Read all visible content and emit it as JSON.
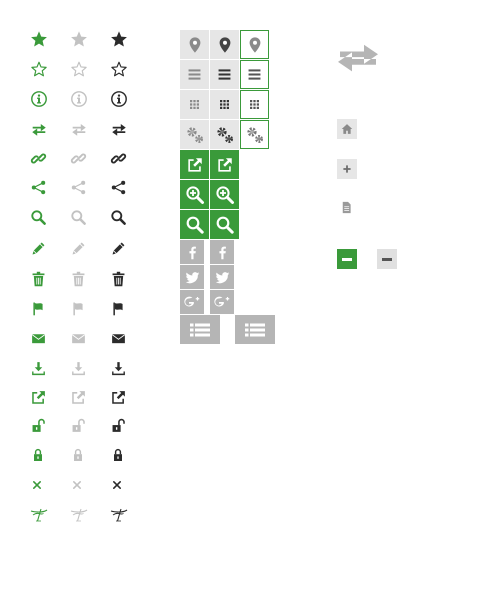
{
  "colors": {
    "green": "#3a9a3a",
    "light_grey": "#c2c2c2",
    "dark": "#2b2b2b",
    "tile_light": "#e6e6e6",
    "tile_grey": "#b5b5b5",
    "tile_green": "#3a9a3a"
  },
  "icon_rows": [
    "star-filled-icon",
    "star-outline-icon",
    "info-icon",
    "swap-arrows-icon",
    "link-icon",
    "share-icon",
    "search-icon",
    "pencil-icon",
    "trash-icon",
    "flag-icon",
    "envelope-icon",
    "download-icon",
    "external-link-icon",
    "unlock-icon",
    "lock-icon",
    "close-icon",
    "signature-icon"
  ],
  "icon_variants": [
    "green",
    "light",
    "dark"
  ],
  "tile_grid": {
    "map_pin": [
      "pin-tile-light",
      "pin-tile-dark",
      "pin-tile-outlined"
    ],
    "menu": [
      "menu-tile-light",
      "menu-tile-dark",
      "menu-tile-outlined"
    ],
    "grid": [
      "grid-tile-light",
      "grid-tile-dark",
      "grid-tile-outlined"
    ],
    "gears": [
      "gears-tile-light",
      "gears-tile-dark",
      "gears-tile-outlined"
    ],
    "green_tiles": [
      "external-link-tile",
      "zoom-in-tile",
      "search-tile"
    ],
    "social_tiles": [
      "facebook-tile",
      "twitter-tile",
      "google-plus-tile"
    ],
    "list_buttons": [
      "list-button-1",
      "list-button-2"
    ]
  },
  "right_column": {
    "large_icon": "swap-arrows-large-icon",
    "small_icons": [
      "home-icon",
      "plus-icon",
      "document-icon"
    ],
    "collapse_toggles": [
      "collapse-toggle-active",
      "collapse-toggle-inactive"
    ]
  }
}
